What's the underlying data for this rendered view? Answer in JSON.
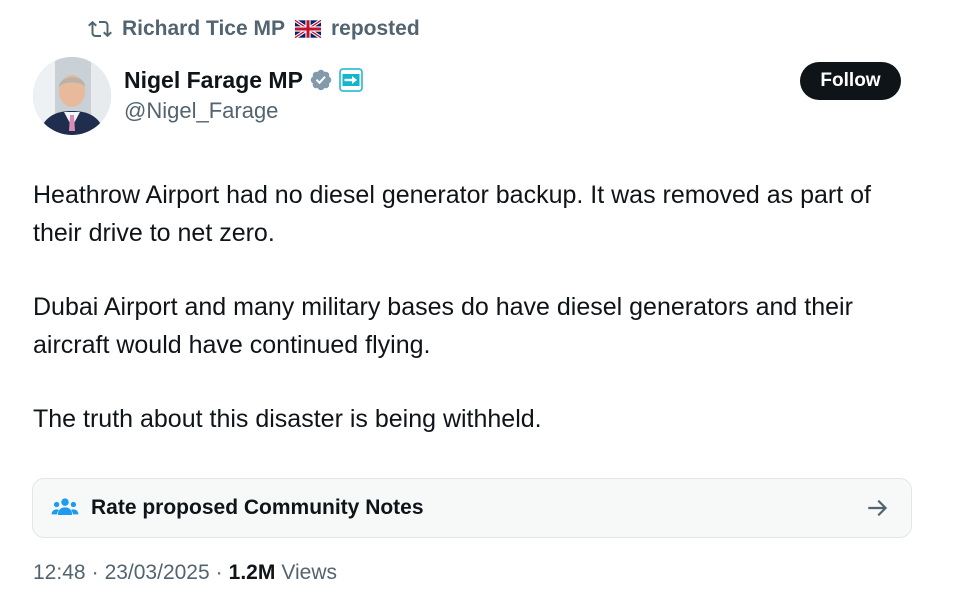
{
  "repost": {
    "reposter_name": "Richard Tice MP",
    "flag_icon": "uk-flag-icon",
    "suffix": "reposted"
  },
  "author": {
    "display_name": "Nigel Farage MP",
    "handle": "@Nigel_Farage",
    "verified_color": "#829aab",
    "affiliate_badge": "reform-uk-badge",
    "affiliate_color": "#12b6cf"
  },
  "follow_button": {
    "label": "Follow"
  },
  "tweet": {
    "paragraphs": [
      "Heathrow Airport had no diesel generator backup. It was removed as part of their drive to net zero.",
      "Dubai Airport and many military bases do have diesel generators and their aircraft would have continued flying.",
      "The truth about this disaster is being withheld."
    ]
  },
  "community_notes": {
    "label": "Rate proposed Community Notes",
    "icon": "people-icon",
    "icon_color": "#1d9bf0"
  },
  "meta": {
    "time": "12:48",
    "date": "23/03/2025",
    "views_count": "1.2M",
    "views_label": "Views",
    "separator": "·"
  }
}
